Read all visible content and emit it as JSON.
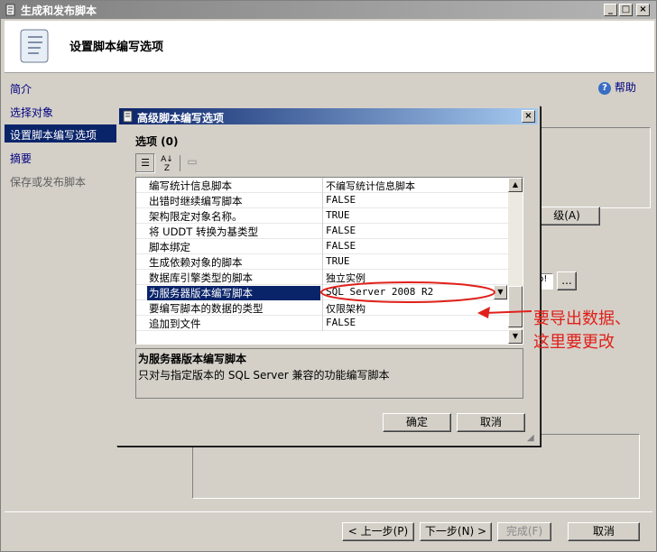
{
  "window": {
    "title": "生成和发布脚本",
    "controls": [
      "_",
      "□",
      "×"
    ],
    "page_heading": "设置脚本编写选项"
  },
  "nav": {
    "items": [
      {
        "label": "简介",
        "state": "normal"
      },
      {
        "label": "选择对象",
        "state": "normal"
      },
      {
        "label": "设置脚本编写选项",
        "state": "selected"
      },
      {
        "label": "摘要",
        "state": "normal"
      },
      {
        "label": "保存或发布脚本",
        "state": "disabled"
      }
    ]
  },
  "help": {
    "label": "帮助"
  },
  "background_fragments": {
    "advanced_button": "级(A)",
    "path_fragment": "p!",
    "browse_button": "..."
  },
  "footer": {
    "prev_button": "< 上一步(P)",
    "next_button": "下一步(N) >",
    "finish_button": "完成(F)",
    "cancel_button": "取消"
  },
  "dialog": {
    "title": "高级脚本编写选项",
    "close": "×",
    "section_label": "选项 (0)",
    "rows": [
      {
        "name": "编写统计信息脚本",
        "value": "不编写统计信息脚本"
      },
      {
        "name": "出错时继续编写脚本",
        "value": "FALSE"
      },
      {
        "name": "架构限定对象名称。",
        "value": "TRUE"
      },
      {
        "name": "将 UDDT 转换为基类型",
        "value": "FALSE"
      },
      {
        "name": "脚本绑定",
        "value": "FALSE"
      },
      {
        "name": "生成依赖对象的脚本",
        "value": "TRUE"
      },
      {
        "name": "数据库引擎类型的脚本",
        "value": "独立实例"
      },
      {
        "name": "为服务器版本编写脚本",
        "value": "SQL Server 2008 R2",
        "selected": true
      },
      {
        "name": "要编写脚本的数据的类型",
        "value": "仅限架构"
      },
      {
        "name": "追加到文件",
        "value": "FALSE"
      }
    ],
    "description_title": "为服务器版本编写脚本",
    "description_text": "只对与指定版本的 SQL Server 兼容的功能编写脚本",
    "ok_button": "确定",
    "cancel_button": "取消"
  },
  "annotation": {
    "line1": "要导出数据、",
    "line2": "这里要更改",
    "color": "#e0201a"
  }
}
